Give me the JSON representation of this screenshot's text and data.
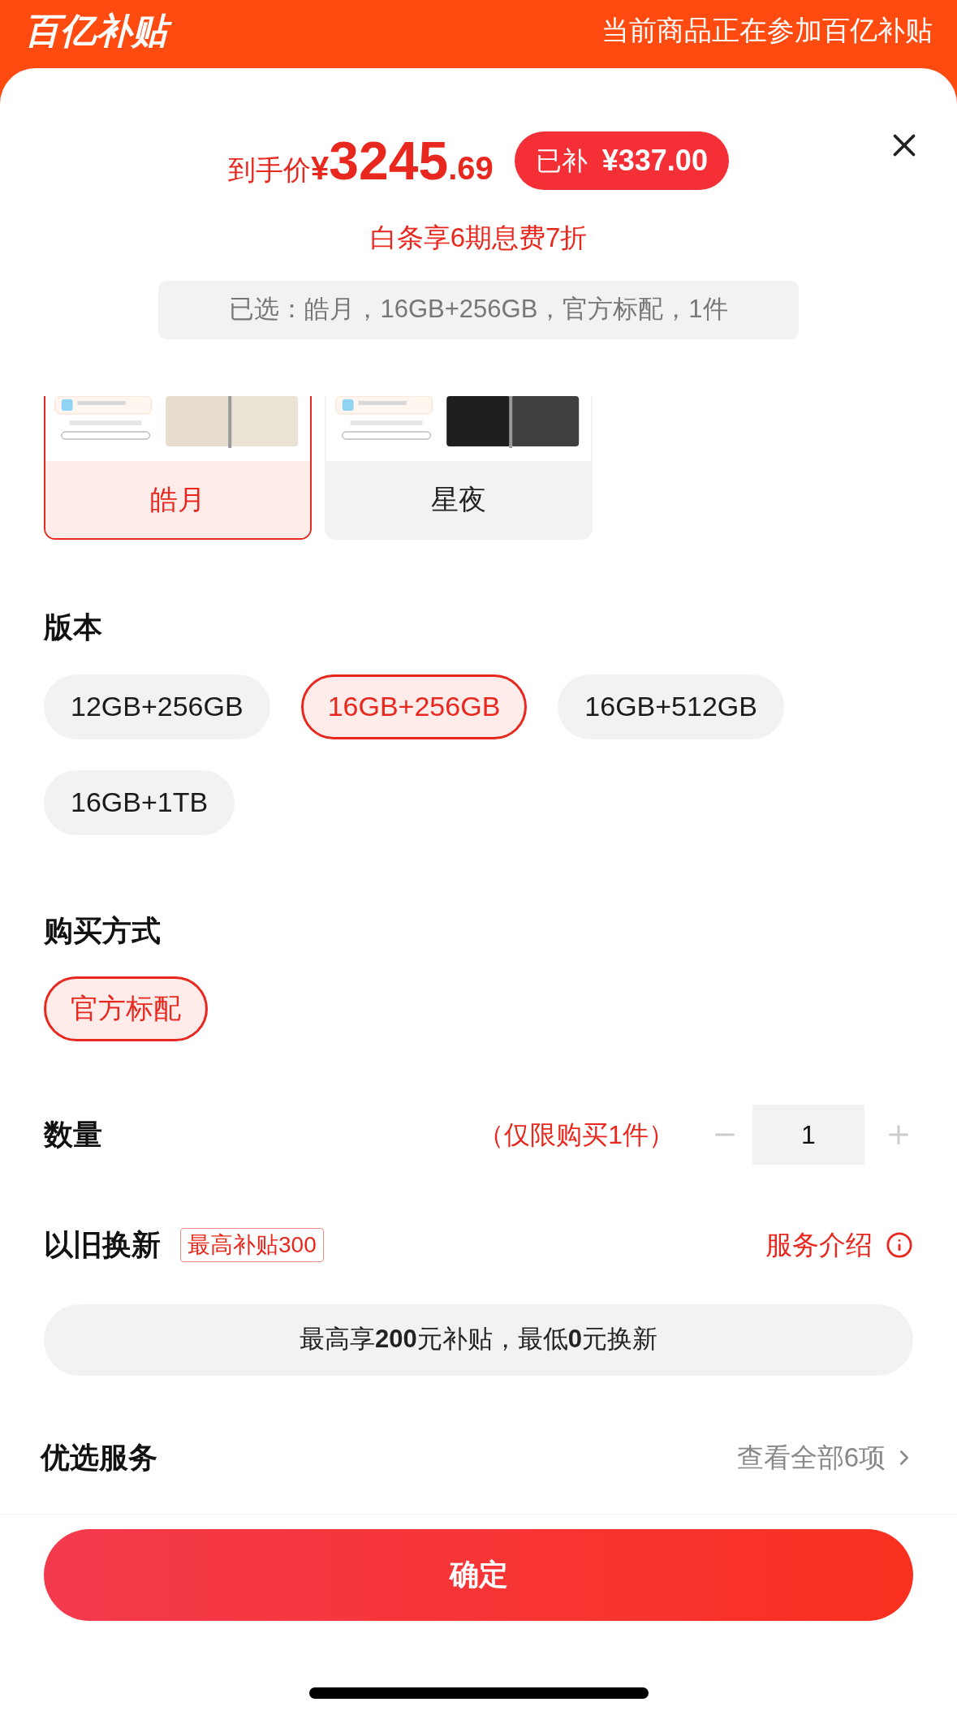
{
  "header": {
    "logo": "百亿补贴",
    "notice": "当前商品正在参加百亿补贴"
  },
  "price": {
    "label": "到手价",
    "currency": "¥",
    "integer": "3245",
    "decimal": ".69",
    "subsidy_label": "已补",
    "subsidy_amount": "¥337.00"
  },
  "installment": "白条享6期息费7折",
  "selected_summary": "已选：皓月，16GB+256GB，官方标配，1件",
  "colors": [
    {
      "label": "皓月",
      "selected": true,
      "kind": "picture",
      "color": "#e6ddcc"
    },
    {
      "label": "星夜",
      "selected": false,
      "kind": "picture",
      "color": "#1d1f20"
    }
  ],
  "version": {
    "title": "版本",
    "options": [
      {
        "label": "12GB+256GB",
        "selected": false
      },
      {
        "label": "16GB+256GB",
        "selected": true
      },
      {
        "label": "16GB+512GB",
        "selected": false
      },
      {
        "label": "16GB+1TB",
        "selected": false
      }
    ]
  },
  "purchase_method": {
    "title": "购买方式",
    "options": [
      {
        "label": "官方标配",
        "selected": true
      }
    ]
  },
  "quantity": {
    "title": "数量",
    "limit": "（仅限购买1件）",
    "value": "1",
    "minus_disabled": true,
    "plus_disabled": true
  },
  "trade_in": {
    "title": "以旧换新",
    "tag": "最高补贴300",
    "link": "服务介绍",
    "info": "最高享**200**元补贴，最低**0**元换新"
  },
  "services": {
    "title": "优选服务",
    "link": "查看全部6项"
  },
  "confirm_button": "确定"
}
